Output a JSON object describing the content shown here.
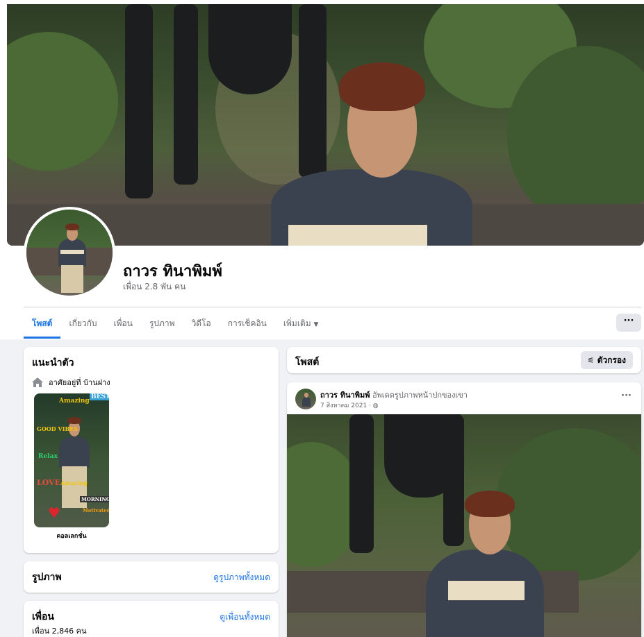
{
  "profile": {
    "name": "ถาวร ทินาพิมพ์",
    "friends_summary": "เพื่อน 2.8 พัน คน"
  },
  "tabs": [
    "โพสต์",
    "เกี่ยวกับ",
    "เพื่อน",
    "รูปภาพ",
    "วิดีโอ",
    "การเช็คอิน",
    "เพิ่มเติม"
  ],
  "more_button": "···",
  "intro": {
    "title": "แนะนำตัว",
    "lives_in": "อาศัยอยู่ที่ บ้านฝาง",
    "collection_label": "คอลเลกชั่น",
    "stickers": [
      "Amazing",
      "BEST",
      "GOOD VIBES",
      "Relax",
      "LOVE",
      "MORNING",
      "Motivated",
      "GOOD"
    ]
  },
  "photos": {
    "title": "รูปภาพ",
    "see_all": "ดูรูปภาพทั้งหมด"
  },
  "friends": {
    "title": "เพื่อน",
    "count": "เพื่อน 2,846 คน",
    "see_all": "ดูเพื่อนทั้งหมด"
  },
  "posts": {
    "title": "โพสต์",
    "filter_label": "ตัวกรอง"
  },
  "post": {
    "author": "ถาวร ทินาพิมพ์",
    "action": "อัพเดตรูปภาพหน้าปกของเขา",
    "date": "7 สิงหาคม 2021 ·",
    "menu": "···"
  },
  "colors": {
    "accent": "#1b74e4",
    "muted": "#65676b",
    "background": "#f0f2f5"
  }
}
